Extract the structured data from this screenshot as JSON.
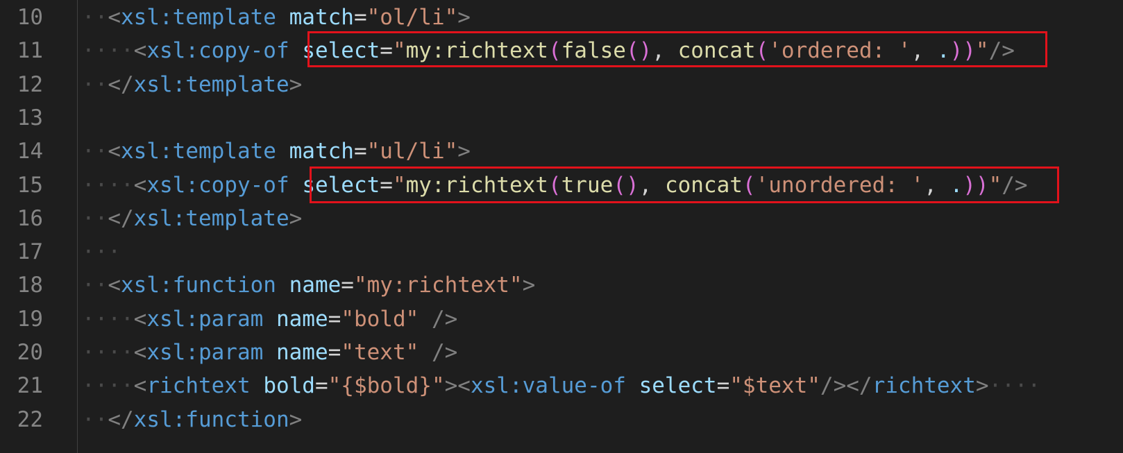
{
  "editor": {
    "line_numbers": [
      "10",
      "11",
      "12",
      "13",
      "14",
      "15",
      "16",
      "17",
      "18",
      "19",
      "20",
      "21",
      "22"
    ],
    "lines": [
      {
        "ws": "··",
        "tokens": [
          {
            "c": "p",
            "v": "<"
          },
          {
            "c": "t",
            "v": "xsl:template"
          },
          {
            "c": "eq",
            "v": " "
          },
          {
            "c": "a",
            "v": "match"
          },
          {
            "c": "eq",
            "v": "="
          },
          {
            "c": "s",
            "v": "\"ol/li\""
          },
          {
            "c": "p",
            "v": ">"
          }
        ]
      },
      {
        "ws": "····",
        "tokens": [
          {
            "c": "p",
            "v": "<"
          },
          {
            "c": "t",
            "v": "xsl:copy-of"
          },
          {
            "c": "eq",
            "v": " "
          },
          {
            "c": "a",
            "v": "select"
          },
          {
            "c": "eq",
            "v": "="
          },
          {
            "c": "s",
            "v": "\""
          },
          {
            "c": "f",
            "v": "my:richtext"
          },
          {
            "c": "br",
            "v": "("
          },
          {
            "c": "f",
            "v": "false"
          },
          {
            "c": "br",
            "v": "()"
          },
          {
            "c": "eq",
            "v": ", "
          },
          {
            "c": "f",
            "v": "concat"
          },
          {
            "c": "br",
            "v": "("
          },
          {
            "c": "s",
            "v": "'ordered: '"
          },
          {
            "c": "eq",
            "v": ", "
          },
          {
            "c": "a",
            "v": "."
          },
          {
            "c": "br",
            "v": "))"
          },
          {
            "c": "s",
            "v": "\""
          },
          {
            "c": "p",
            "v": "/>"
          }
        ]
      },
      {
        "ws": "··",
        "tokens": [
          {
            "c": "p",
            "v": "</"
          },
          {
            "c": "t",
            "v": "xsl:template"
          },
          {
            "c": "p",
            "v": ">"
          }
        ]
      },
      {
        "ws": "",
        "tokens": []
      },
      {
        "ws": "··",
        "tokens": [
          {
            "c": "p",
            "v": "<"
          },
          {
            "c": "t",
            "v": "xsl:template"
          },
          {
            "c": "eq",
            "v": " "
          },
          {
            "c": "a",
            "v": "match"
          },
          {
            "c": "eq",
            "v": "="
          },
          {
            "c": "s",
            "v": "\"ul/li\""
          },
          {
            "c": "p",
            "v": ">"
          }
        ]
      },
      {
        "ws": "····",
        "tokens": [
          {
            "c": "p",
            "v": "<"
          },
          {
            "c": "t",
            "v": "xsl:copy-of"
          },
          {
            "c": "eq",
            "v": " "
          },
          {
            "c": "a",
            "v": "select"
          },
          {
            "c": "eq",
            "v": "="
          },
          {
            "c": "s",
            "v": "\""
          },
          {
            "c": "f",
            "v": "my:richtext"
          },
          {
            "c": "br",
            "v": "("
          },
          {
            "c": "f",
            "v": "true"
          },
          {
            "c": "br",
            "v": "()"
          },
          {
            "c": "eq",
            "v": ", "
          },
          {
            "c": "f",
            "v": "concat"
          },
          {
            "c": "br",
            "v": "("
          },
          {
            "c": "s",
            "v": "'unordered: '"
          },
          {
            "c": "eq",
            "v": ", "
          },
          {
            "c": "a",
            "v": "."
          },
          {
            "c": "br",
            "v": "))"
          },
          {
            "c": "s",
            "v": "\""
          },
          {
            "c": "p",
            "v": "/>"
          }
        ]
      },
      {
        "ws": "··",
        "tokens": [
          {
            "c": "p",
            "v": "</"
          },
          {
            "c": "t",
            "v": "xsl:template"
          },
          {
            "c": "p",
            "v": ">"
          }
        ]
      },
      {
        "ws": "···",
        "tokens": []
      },
      {
        "ws": "··",
        "tokens": [
          {
            "c": "p",
            "v": "<"
          },
          {
            "c": "t",
            "v": "xsl:function"
          },
          {
            "c": "eq",
            "v": " "
          },
          {
            "c": "a",
            "v": "name"
          },
          {
            "c": "eq",
            "v": "="
          },
          {
            "c": "s",
            "v": "\"my:richtext\""
          },
          {
            "c": "p",
            "v": ">"
          }
        ]
      },
      {
        "ws": "····",
        "tokens": [
          {
            "c": "p",
            "v": "<"
          },
          {
            "c": "t",
            "v": "xsl:param"
          },
          {
            "c": "eq",
            "v": " "
          },
          {
            "c": "a",
            "v": "name"
          },
          {
            "c": "eq",
            "v": "="
          },
          {
            "c": "s",
            "v": "\"bold\""
          },
          {
            "c": "eq",
            "v": " "
          },
          {
            "c": "p",
            "v": "/>"
          }
        ]
      },
      {
        "ws": "····",
        "tokens": [
          {
            "c": "p",
            "v": "<"
          },
          {
            "c": "t",
            "v": "xsl:param"
          },
          {
            "c": "eq",
            "v": " "
          },
          {
            "c": "a",
            "v": "name"
          },
          {
            "c": "eq",
            "v": "="
          },
          {
            "c": "s",
            "v": "\"text\""
          },
          {
            "c": "eq",
            "v": " "
          },
          {
            "c": "p",
            "v": "/>"
          }
        ]
      },
      {
        "ws": "····",
        "tokens": [
          {
            "c": "p",
            "v": "<"
          },
          {
            "c": "t",
            "v": "richtext"
          },
          {
            "c": "eq",
            "v": " "
          },
          {
            "c": "a",
            "v": "bold"
          },
          {
            "c": "eq",
            "v": "="
          },
          {
            "c": "s",
            "v": "\"{$bold}\""
          },
          {
            "c": "p",
            "v": ">"
          },
          {
            "c": "p",
            "v": "<"
          },
          {
            "c": "t",
            "v": "xsl:value-of"
          },
          {
            "c": "eq",
            "v": " "
          },
          {
            "c": "a",
            "v": "select"
          },
          {
            "c": "eq",
            "v": "="
          },
          {
            "c": "s",
            "v": "\"$text\""
          },
          {
            "c": "p",
            "v": "/>"
          },
          {
            "c": "p",
            "v": "</"
          },
          {
            "c": "t",
            "v": "richtext"
          },
          {
            "c": "p",
            "v": ">"
          },
          {
            "c": "ws",
            "v": "····"
          }
        ]
      },
      {
        "ws": "··",
        "tokens": [
          {
            "c": "p",
            "v": "</"
          },
          {
            "c": "t",
            "v": "xsl:function"
          },
          {
            "c": "p",
            "v": ">"
          }
        ]
      }
    ]
  },
  "highlights": [
    {
      "line": "11",
      "text": "select=\"my:richtext(false(), concat('ordered: ', .))\""
    },
    {
      "line": "15",
      "text": "select=\"my:richtext(true(), concat('unordered: ', .))\""
    }
  ],
  "colors": {
    "background": "#1e1e1e",
    "line_number": "#858585",
    "tag_punctuation": "#808080",
    "tag_name": "#569cd6",
    "attribute": "#9cdcfe",
    "string": "#ce9178",
    "function": "#dcdcaa",
    "bracket": "#da70d6",
    "highlight_border": "#e2121b"
  }
}
